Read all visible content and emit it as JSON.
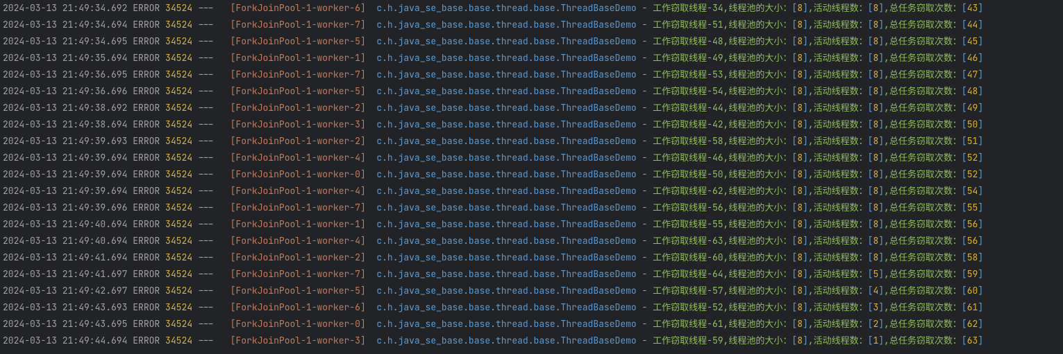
{
  "logger_class": "c.h.java_se_base.base.thread.base.ThreadBaseDemo",
  "level": "ERROR",
  "pid": "34524",
  "pool_size_label": "线程池的大小：",
  "active_label": "活动线程数：",
  "steal_label": "总任务窃取次数：",
  "msg_prefix": "工作窃取线程-",
  "rows": [
    {
      "ts": "2024-03-13 21:49:34.692",
      "worker": "6",
      "thread_num": "34",
      "pool": "8",
      "active": "8",
      "steal": "43"
    },
    {
      "ts": "2024-03-13 21:49:34.694",
      "worker": "7",
      "thread_num": "51",
      "pool": "8",
      "active": "8",
      "steal": "44"
    },
    {
      "ts": "2024-03-13 21:49:34.695",
      "worker": "5",
      "thread_num": "48",
      "pool": "8",
      "active": "8",
      "steal": "45"
    },
    {
      "ts": "2024-03-13 21:49:35.694",
      "worker": "1",
      "thread_num": "49",
      "pool": "8",
      "active": "8",
      "steal": "46"
    },
    {
      "ts": "2024-03-13 21:49:36.695",
      "worker": "7",
      "thread_num": "53",
      "pool": "8",
      "active": "8",
      "steal": "47"
    },
    {
      "ts": "2024-03-13 21:49:36.696",
      "worker": "5",
      "thread_num": "54",
      "pool": "8",
      "active": "8",
      "steal": "48"
    },
    {
      "ts": "2024-03-13 21:49:38.692",
      "worker": "2",
      "thread_num": "44",
      "pool": "8",
      "active": "8",
      "steal": "49"
    },
    {
      "ts": "2024-03-13 21:49:38.694",
      "worker": "3",
      "thread_num": "42",
      "pool": "8",
      "active": "8",
      "steal": "50"
    },
    {
      "ts": "2024-03-13 21:49:39.693",
      "worker": "2",
      "thread_num": "58",
      "pool": "8",
      "active": "8",
      "steal": "51"
    },
    {
      "ts": "2024-03-13 21:49:39.694",
      "worker": "4",
      "thread_num": "46",
      "pool": "8",
      "active": "8",
      "steal": "52"
    },
    {
      "ts": "2024-03-13 21:49:39.694",
      "worker": "0",
      "thread_num": "50",
      "pool": "8",
      "active": "8",
      "steal": "52"
    },
    {
      "ts": "2024-03-13 21:49:39.694",
      "worker": "4",
      "thread_num": "62",
      "pool": "8",
      "active": "8",
      "steal": "54"
    },
    {
      "ts": "2024-03-13 21:49:39.696",
      "worker": "7",
      "thread_num": "56",
      "pool": "8",
      "active": "8",
      "steal": "55"
    },
    {
      "ts": "2024-03-13 21:49:40.694",
      "worker": "1",
      "thread_num": "55",
      "pool": "8",
      "active": "8",
      "steal": "56"
    },
    {
      "ts": "2024-03-13 21:49:40.694",
      "worker": "4",
      "thread_num": "63",
      "pool": "8",
      "active": "8",
      "steal": "56"
    },
    {
      "ts": "2024-03-13 21:49:41.694",
      "worker": "2",
      "thread_num": "60",
      "pool": "8",
      "active": "8",
      "steal": "58"
    },
    {
      "ts": "2024-03-13 21:49:41.697",
      "worker": "7",
      "thread_num": "64",
      "pool": "8",
      "active": "5",
      "steal": "59"
    },
    {
      "ts": "2024-03-13 21:49:42.697",
      "worker": "5",
      "thread_num": "57",
      "pool": "8",
      "active": "4",
      "steal": "60"
    },
    {
      "ts": "2024-03-13 21:49:43.693",
      "worker": "6",
      "thread_num": "52",
      "pool": "8",
      "active": "3",
      "steal": "61"
    },
    {
      "ts": "2024-03-13 21:49:43.695",
      "worker": "0",
      "thread_num": "61",
      "pool": "8",
      "active": "2",
      "steal": "62"
    },
    {
      "ts": "2024-03-13 21:49:44.694",
      "worker": "3",
      "thread_num": "59",
      "pool": "8",
      "active": "1",
      "steal": "63"
    }
  ]
}
